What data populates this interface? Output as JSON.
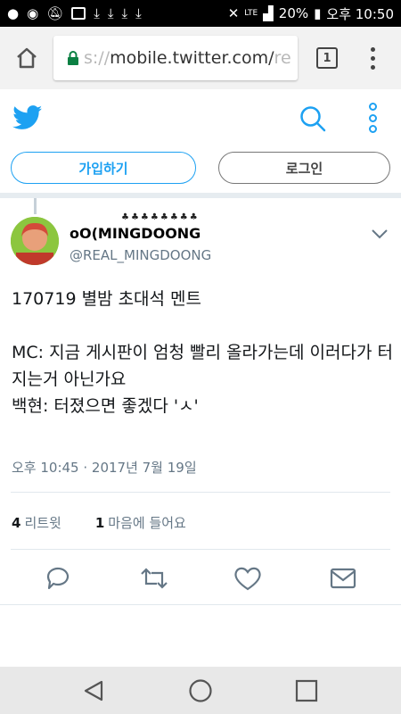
{
  "status_bar": {
    "battery": "20%",
    "time": "오후 10:50",
    "lte": "LTE"
  },
  "browser": {
    "url_prefix": "s://",
    "url_main": "mobile.twitter.com/",
    "url_tail": "re",
    "tab_count": "1"
  },
  "twitter_header": {
    "signup_label": "가입하기",
    "login_label": "로그인"
  },
  "tweet": {
    "author_name": "oO(MINGDOONG",
    "author_sprouts": "♣♣♣♣♣♣♣♣",
    "author_handle": "@REAL_MINGDOONG",
    "text": "170719 별밤 초대석 멘트\n\nMC: 지금 게시판이 엄청 빨리 올라가는데 이러다가 터지는거 아닌가요\n백현: 터졌으면 좋겠다 'ㅅ'",
    "timestamp": "오후 10:45 · 2017년 7월 19일",
    "retweet_count": "4",
    "retweet_label": "리트윗",
    "like_count": "1",
    "like_label": "마음에 들어요"
  },
  "colors": {
    "twitter_blue": "#1da1f2",
    "text_dark": "#14171a",
    "text_gray": "#657786"
  },
  "icons": [
    "home-icon",
    "lock-icon",
    "tabs-icon",
    "overflow-menu-icon",
    "twitter-bird-icon",
    "search-icon",
    "more-vertical-icon",
    "caret-down-icon",
    "reply-icon",
    "retweet-icon",
    "like-icon",
    "message-icon",
    "back-icon",
    "home-circle-icon",
    "recents-icon"
  ]
}
